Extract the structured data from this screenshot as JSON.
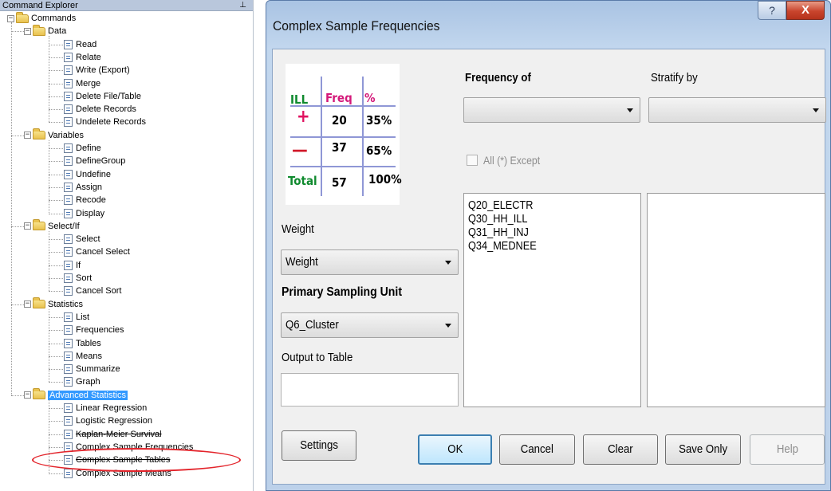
{
  "explorer": {
    "title": "Command Explorer",
    "pin_glyph": "⊥",
    "root": "Commands",
    "groups": [
      {
        "label": "Data",
        "items": [
          "Read",
          "Relate",
          "Write (Export)",
          "Merge",
          "Delete File/Table",
          "Delete Records",
          "Undelete Records"
        ]
      },
      {
        "label": "Variables",
        "items": [
          "Define",
          "DefineGroup",
          "Undefine",
          "Assign",
          "Recode",
          "Display"
        ]
      },
      {
        "label": "Select/If",
        "items": [
          "Select",
          "Cancel Select",
          "If",
          "Sort",
          "Cancel Sort"
        ]
      },
      {
        "label": "Statistics",
        "items": [
          "List",
          "Frequencies",
          "Tables",
          "Means",
          "Summarize",
          "Graph"
        ]
      },
      {
        "label": "Advanced Statistics",
        "items": [
          "Linear Regression",
          "Logistic Regression",
          "Kaplan-Meier Survival",
          "Complex Sample Frequencies",
          "Complex Sample Tables",
          "Complex Sample Means"
        ]
      }
    ],
    "selected_group": "Advanced Statistics",
    "highlighted_item": "Complex Sample Frequencies",
    "highlight_color": "#e3242b",
    "selection_color": "#3399ff"
  },
  "dialog": {
    "title": "Complex Sample Frequencies",
    "help_glyph": "?",
    "close_glyph": "X",
    "freq_table": {
      "headers": [
        "ILL",
        "Freq",
        "%"
      ],
      "rows": [
        {
          "label": "+",
          "freq": "20",
          "pct": "35%"
        },
        {
          "label": "—",
          "freq": "37",
          "pct": "65%"
        },
        {
          "label": "Total",
          "freq": "57",
          "pct": "100%"
        }
      ],
      "colors": {
        "ill": "#0f8a2e",
        "freq": "#d4197a",
        "plus": "#e0115f",
        "minus": "#d11a2a",
        "total": "#0f8a2e",
        "grid": "#8f97d6"
      }
    },
    "frequency_of": {
      "label": "Frequency of",
      "value": ""
    },
    "stratify_by": {
      "label": "Stratify by",
      "value": ""
    },
    "all_except": {
      "label": "All (*) Except",
      "checked": false
    },
    "variables": [
      "Q20_ELECTR",
      "Q30_HH_ILL",
      "Q31_HH_INJ",
      "Q34_MEDNEE"
    ],
    "weight": {
      "label": "Weight",
      "value": "Weight"
    },
    "psu": {
      "label": "Primary Sampling Unit",
      "value": "Q6_Cluster"
    },
    "output_table": {
      "label": "Output to Table",
      "value": ""
    },
    "buttons": {
      "settings": "Settings",
      "ok": "OK",
      "cancel": "Cancel",
      "clear": "Clear",
      "save_only": "Save Only",
      "help": "Help"
    }
  }
}
